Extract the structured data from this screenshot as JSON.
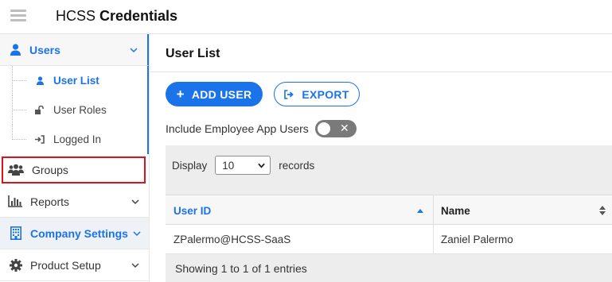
{
  "app": {
    "brand_light": "HCSS",
    "brand_bold": "Credentials"
  },
  "sidebar": {
    "users": {
      "label": "Users",
      "icon": "user-icon"
    },
    "sub_items": [
      {
        "label": "User List",
        "icon": "user-small-icon",
        "active": true
      },
      {
        "label": "User Roles",
        "icon": "unlock-icon",
        "active": false
      },
      {
        "label": "Logged In",
        "icon": "sign-in-icon",
        "active": false
      }
    ],
    "groups": {
      "label": "Groups",
      "icon": "users-group-icon"
    },
    "reports": {
      "label": "Reports",
      "icon": "bar-chart-icon"
    },
    "company": {
      "label": "Company Settings",
      "icon": "building-icon"
    },
    "product": {
      "label": "Product Setup",
      "icon": "gear-icon"
    }
  },
  "main": {
    "title": "User List",
    "add_label": "ADD USER",
    "add_icon": "plus-icon",
    "export_label": "EXPORT",
    "export_icon": "export-icon",
    "include_label": "Include Employee App Users",
    "include_toggle_on": false,
    "display_label": "Display",
    "records_label": "records",
    "page_size": "10",
    "columns": [
      "User ID",
      "Name"
    ],
    "rows": [
      {
        "user_id": "ZPalermo@HCSS-SaaS",
        "name": "Zaniel Palermo"
      }
    ],
    "showing": "Showing 1 to 1 of 1 entries"
  },
  "colors": {
    "accent": "#1a73e8",
    "highlight_box": "#d9141e",
    "toggle_off": "#7a7a7a"
  }
}
